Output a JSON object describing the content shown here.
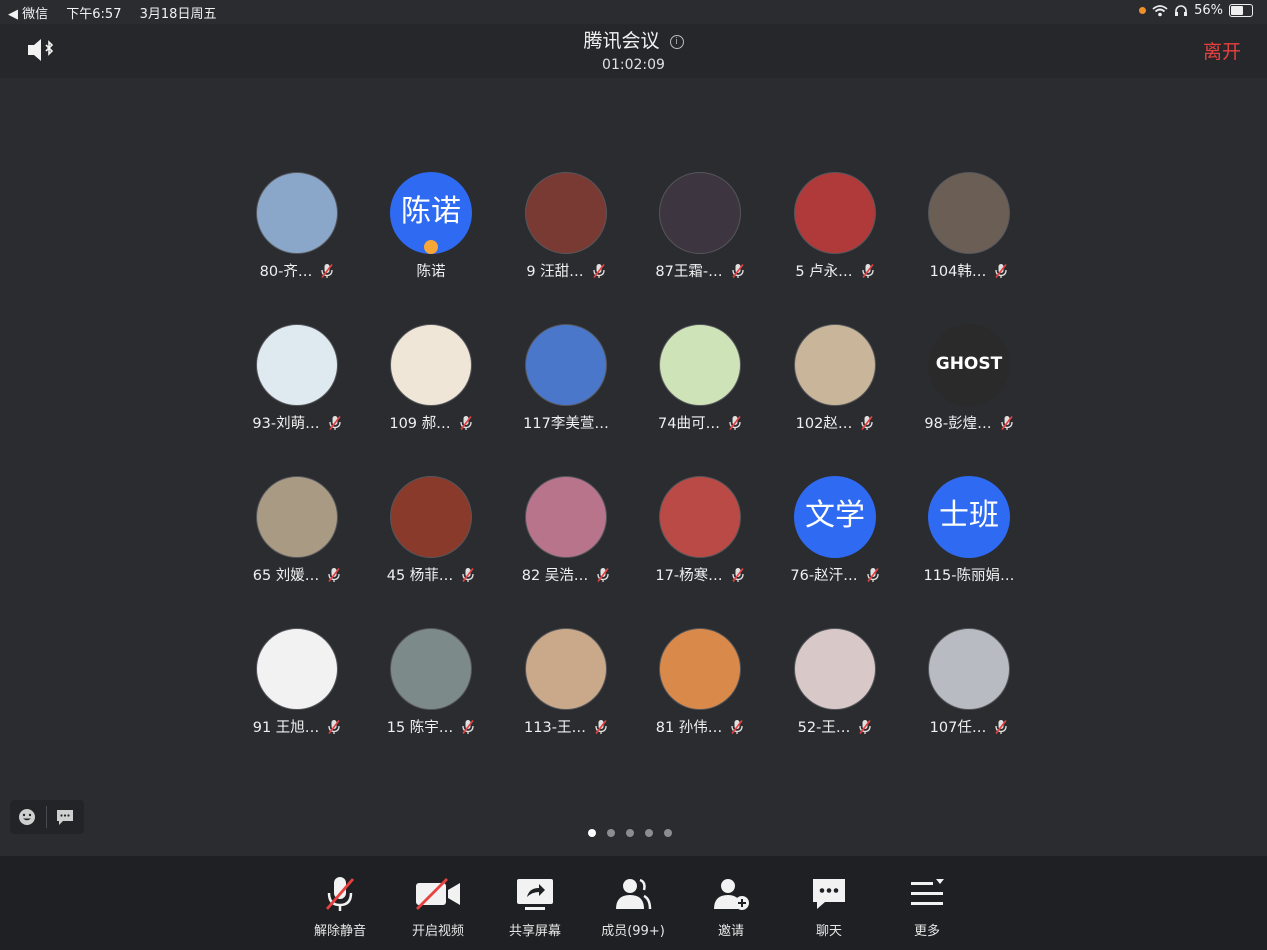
{
  "status_bar": {
    "back_app": "◀ 微信",
    "time": "下午6:57",
    "date": "3月18日周五",
    "battery": "56%"
  },
  "header": {
    "title": "腾讯会议",
    "timer": "01:02:09",
    "leave_label": "离开"
  },
  "participants": [
    {
      "name": "80-齐…",
      "avatar_text": "",
      "avatar_bg": "#8aa7c9",
      "mic_muted": true
    },
    {
      "name": "陈诺",
      "avatar_text": "陈诺",
      "avatar_bg": "#2f6bf2",
      "mic_muted": false,
      "is_host": true
    },
    {
      "name": "9 汪甜…",
      "avatar_text": "",
      "avatar_bg": "#7a3a34",
      "mic_muted": true
    },
    {
      "name": "87王霜-…",
      "avatar_text": "",
      "avatar_bg": "#3d3540",
      "mic_muted": true
    },
    {
      "name": "5 卢永…",
      "avatar_text": "",
      "avatar_bg": "#b03a3a",
      "mic_muted": true
    },
    {
      "name": "104韩…",
      "avatar_text": "",
      "avatar_bg": "#6b5f55",
      "mic_muted": true
    },
    {
      "name": "93-刘萌…",
      "avatar_text": "",
      "avatar_bg": "#dfe9f0",
      "mic_muted": true
    },
    {
      "name": "109 郝…",
      "avatar_text": "",
      "avatar_bg": "#efe6d8",
      "mic_muted": true
    },
    {
      "name": "117李美萱…",
      "avatar_text": "",
      "avatar_bg": "#4a77c9",
      "mic_muted": false
    },
    {
      "name": "74曲可…",
      "avatar_text": "",
      "avatar_bg": "#cfe3b8",
      "mic_muted": true
    },
    {
      "name": "102赵…",
      "avatar_text": "",
      "avatar_bg": "#c9b59a",
      "mic_muted": true
    },
    {
      "name": "98-彭煌…",
      "avatar_text": "GHOST",
      "avatar_bg": "#2a2a2a",
      "mic_muted": true
    },
    {
      "name": "65 刘媛…",
      "avatar_text": "",
      "avatar_bg": "#a99a83",
      "mic_muted": true
    },
    {
      "name": "45 杨菲…",
      "avatar_text": "",
      "avatar_bg": "#8a3a2a",
      "mic_muted": true
    },
    {
      "name": "82 吴浩…",
      "avatar_text": "",
      "avatar_bg": "#b7748a",
      "mic_muted": true
    },
    {
      "name": "17-杨寒…",
      "avatar_text": "",
      "avatar_bg": "#b94a45",
      "mic_muted": true
    },
    {
      "name": "76-赵汗…",
      "avatar_text": "文学",
      "avatar_bg": "#2f6bf2",
      "mic_muted": true
    },
    {
      "name": "115-陈丽娟…",
      "avatar_text": "士班",
      "avatar_bg": "#2f6bf2",
      "mic_muted": false
    },
    {
      "name": "91 王旭…",
      "avatar_text": "",
      "avatar_bg": "#f2f2f2",
      "mic_muted": true
    },
    {
      "name": "15 陈宇…",
      "avatar_text": "",
      "avatar_bg": "#7d8a8a",
      "mic_muted": true
    },
    {
      "name": "113-王…",
      "avatar_text": "",
      "avatar_bg": "#c9a98a",
      "mic_muted": true
    },
    {
      "name": "81 孙伟…",
      "avatar_text": "",
      "avatar_bg": "#d98a4a",
      "mic_muted": true
    },
    {
      "name": "52-王…",
      "avatar_text": "",
      "avatar_bg": "#d8c8c8",
      "mic_muted": true
    },
    {
      "name": "107任…",
      "avatar_text": "",
      "avatar_bg": "#b8bcc2",
      "mic_muted": true
    }
  ],
  "pager": {
    "pages": 5,
    "current_page": 1
  },
  "toolbar": {
    "unmute_label": "解除静音",
    "start_video_label": "开启视频",
    "share_screen_label": "共享屏幕",
    "members_label": "成员(99+)",
    "invite_label": "邀请",
    "chat_label": "聊天",
    "more_label": "更多"
  },
  "colors": {
    "background": "#2b2c30",
    "accent_blue": "#2f6bf2",
    "leave_red": "#e8403f",
    "muted_red": "#e8403f"
  }
}
